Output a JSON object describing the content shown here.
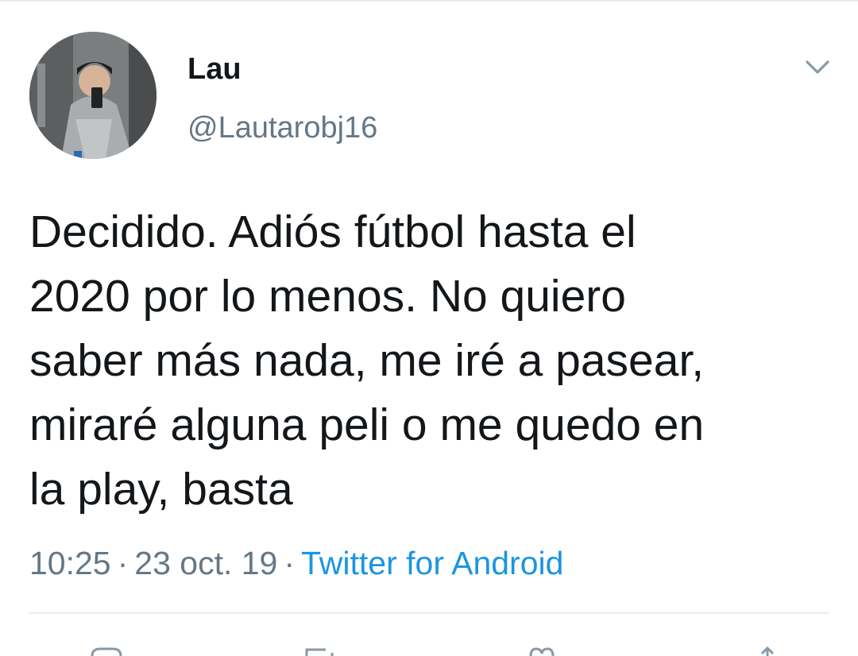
{
  "tweet": {
    "author": {
      "display_name": "Lau",
      "handle": "@Lautarobj16",
      "avatar_icon": "profile-photo"
    },
    "menu_icon": "chevron-down-icon",
    "text_lines": [
      "Decidido. Adiós fútbol hasta el",
      "2020 por lo menos. No quiero",
      "saber más nada, me iré a pasear,",
      "miraré alguna peli o me quedo en",
      "la play, basta"
    ],
    "time": "10:25",
    "date": "23 oct. 19",
    "separator": "·",
    "source": "Twitter for Android",
    "actions": [
      "reply-icon",
      "retweet-icon",
      "like-icon",
      "share-icon"
    ]
  },
  "colors": {
    "text": "#14171a",
    "secondary": "#657786",
    "link": "#1b95e0",
    "divider": "#e6ecf0"
  }
}
